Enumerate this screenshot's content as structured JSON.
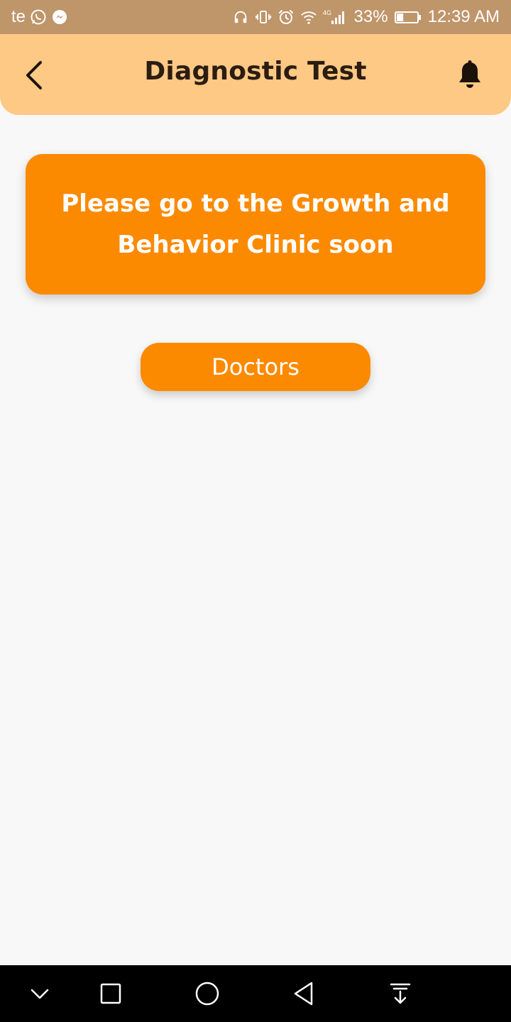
{
  "status_bar": {
    "carrier": "te",
    "icons_left": [
      "whatsapp-icon",
      "messenger-icon"
    ],
    "icons_right": [
      "headphones-icon",
      "vibrate-icon",
      "alarm-icon",
      "wifi-icon",
      "signal-icon",
      "battery-icon"
    ],
    "network_type": "4G",
    "battery_percent": "33%",
    "battery_level": 0.33,
    "time": "12:39 AM"
  },
  "header": {
    "title": "Diagnostic Test",
    "background_color": "#fec885",
    "back_icon": "chevron-left-icon",
    "notification_icon": "bell-icon"
  },
  "message_card": {
    "text": "Please go to the Growth and Behavior Clinic soon",
    "background_color": "#fc8a00"
  },
  "doctors_button": {
    "label": "Doctors",
    "background_color": "#fc8a00"
  },
  "nav_bar": {
    "buttons": [
      "chevron-down-icon",
      "recents-square-icon",
      "home-circle-icon",
      "back-triangle-icon",
      "notification-pull-down-icon"
    ]
  }
}
